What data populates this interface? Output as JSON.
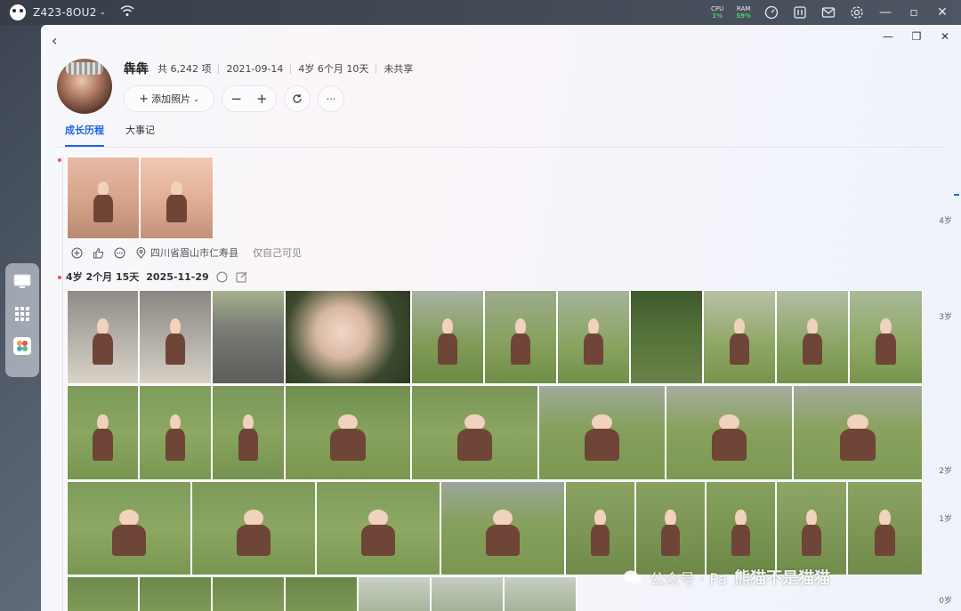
{
  "os": {
    "device_name": "Z423-8OU2",
    "cpu_label": "CPU",
    "cpu_value": "1%",
    "ram_label": "RAM",
    "ram_value": "59%"
  },
  "album": {
    "name": "犇犇",
    "count": "共 6,242 项",
    "birth_date": "2021-09-14",
    "age": "4岁 6个月 10天",
    "share_status": "未共享"
  },
  "toolbar": {
    "add_photo_label": "添加照片",
    "zoom_out": "−",
    "zoom_in": "+",
    "more": "···"
  },
  "tabs": [
    {
      "label": "成长历程",
      "active": true
    },
    {
      "label": "大事记",
      "active": false
    }
  ],
  "entry1": {
    "location": "四川省眉山市仁寿县",
    "visibility": "仅自己可见"
  },
  "entry2": {
    "age": "4岁 2个月 15天",
    "date": "2025-11-29"
  },
  "age_axis": [
    "4岁",
    "3岁",
    "2岁",
    "1岁",
    "0岁"
  ],
  "watermark": {
    "prefix": "公众号 · Pa",
    "name": "熊猫不是猫猫"
  },
  "colors": {
    "accent": "#1f62e6",
    "timeline_dot": "#e05656",
    "meter_ok": "#46d36a"
  }
}
